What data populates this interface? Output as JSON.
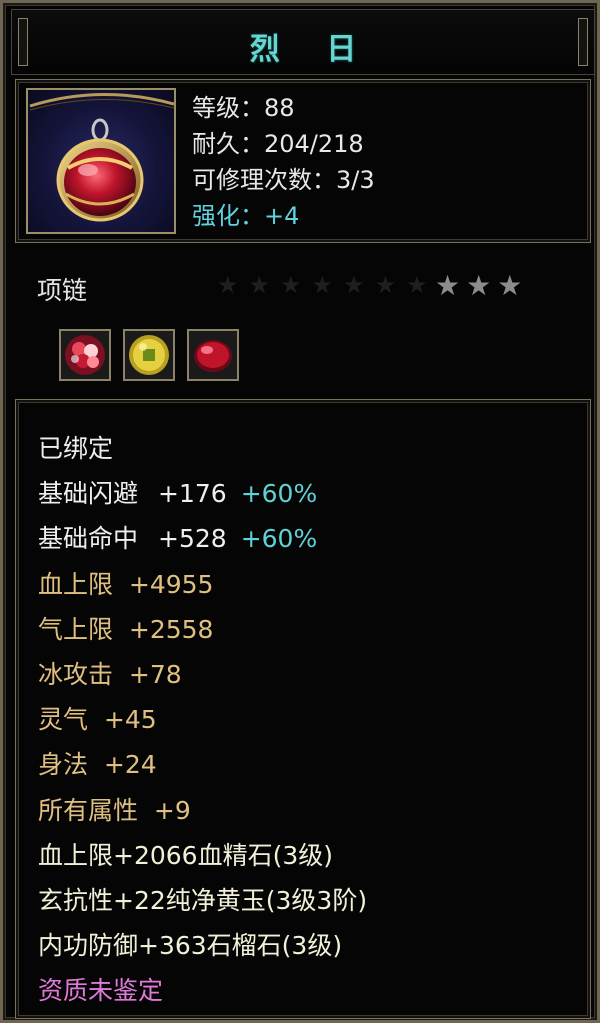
{
  "item": {
    "name": "烈 日",
    "type": "项链",
    "stars_filled": "★★★",
    "stars_empty": "★★★★★★★",
    "icon": "red-gem-pendant-icon"
  },
  "stats": {
    "level": "等级：88",
    "durability": "耐久：204/218",
    "repairs": "可修理次数：3/3",
    "enhance": "强化：+4"
  },
  "gems": [
    {
      "icon": "ruby-cluster-gem-icon"
    },
    {
      "icon": "yellow-jade-coin-gem-icon"
    },
    {
      "icon": "red-garnet-gem-icon"
    }
  ],
  "attributes": {
    "bound": "已绑定",
    "base_dodge": {
      "label": "基础闪避",
      "value": "+176",
      "bonus": "+60%"
    },
    "base_hit": {
      "label": "基础命中",
      "value": "+528",
      "bonus": "+60%"
    },
    "hp_max": "血上限  +4955",
    "qi_max": "气上限  +2558",
    "ice_attack": "冰攻击  +78",
    "spirit": "灵气  +45",
    "agility": "身法  +24",
    "all_attr": "所有属性  +9",
    "gem_line_1": "血上限+2066血精石(3级)",
    "gem_line_2": "玄抗性+22纯净黄玉(3级3阶)",
    "gem_line_3": "内功防御+363石榴石(3级)",
    "quality": "资质未鉴定"
  },
  "colors": {
    "title": "#66d6d2",
    "base_attr": "#efefef",
    "bonus_attr": "#e0c080",
    "percent": "#5fd2d6",
    "quality": "#e07ad8"
  }
}
